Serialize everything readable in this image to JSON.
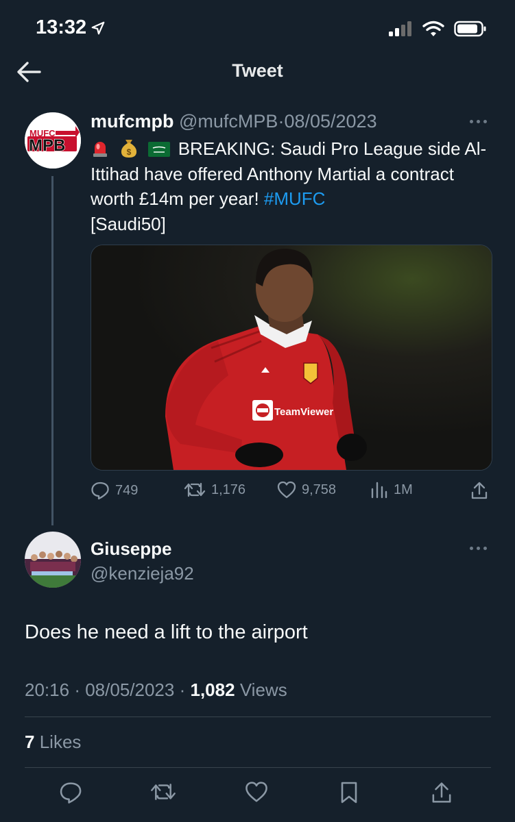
{
  "status": {
    "time": "13:32"
  },
  "header": {
    "title": "Tweet"
  },
  "original_tweet": {
    "avatar_logo_top": "MUFC",
    "avatar_logo_main": "MPB",
    "name": "mufcmpb",
    "handle": "@mufcMPB",
    "separator": "·",
    "date": "08/05/2023",
    "emojis": [
      "siren",
      "money-bag",
      "saudi-flag"
    ],
    "text_main": "BREAKING: Saudi Pro League side Al-Ittihad have offered Anthony Martial a contract worth £14m per year! ",
    "hashtag": "#MUFC",
    "text_tail": "[Saudi50]",
    "image_sponsor": "TeamViewer",
    "stats": {
      "replies": "749",
      "retweets": "1,176",
      "likes": "9,758",
      "views": "1M"
    }
  },
  "reply": {
    "name": "Giuseppe",
    "handle": "@kenzieja92",
    "text": "Does he need a lift to the airport",
    "time": "20:16",
    "separator": "·",
    "date": "08/05/2023",
    "views_count": "1,082",
    "views_label": "Views",
    "likes_count": "7",
    "likes_label": "Likes"
  },
  "icons": [
    "location-arrow",
    "signal",
    "wifi",
    "battery",
    "back-arrow",
    "more",
    "reply",
    "retweet",
    "like",
    "views",
    "share",
    "bookmark"
  ],
  "colors": {
    "background": "#15202b",
    "accent": "#1d9bf0",
    "muted": "#8b98a5",
    "divider": "#38444d"
  }
}
